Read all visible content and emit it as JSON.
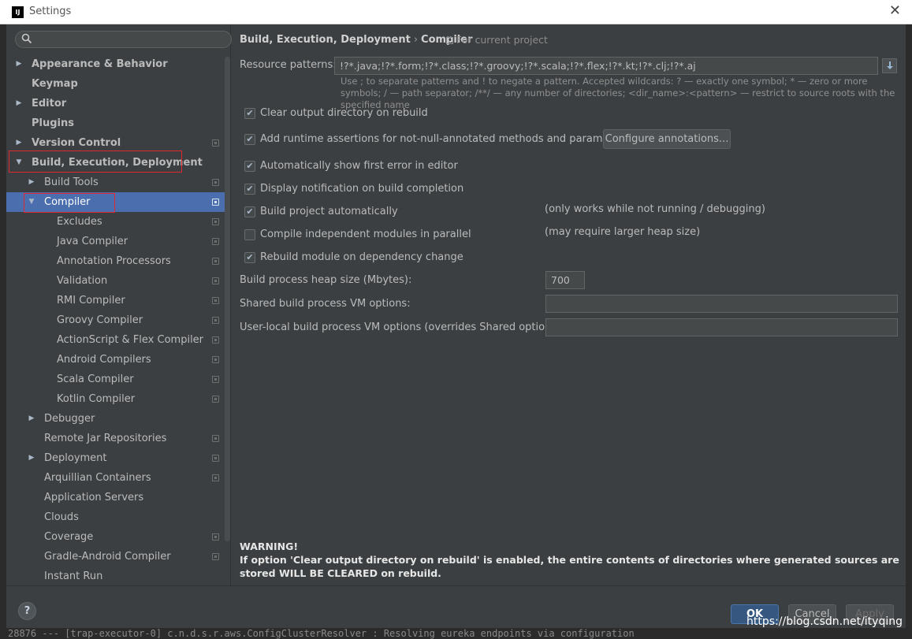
{
  "window": {
    "title": "Settings",
    "logo_text": "IJ"
  },
  "search": {
    "placeholder": ""
  },
  "tree": [
    {
      "label": "Appearance & Behavior",
      "arrow": "▶",
      "bold": true,
      "level": 0
    },
    {
      "label": "Keymap",
      "arrow": "",
      "bold": true,
      "level": 0
    },
    {
      "label": "Editor",
      "arrow": "▶",
      "bold": true,
      "level": 0
    },
    {
      "label": "Plugins",
      "arrow": "",
      "bold": true,
      "level": 0
    },
    {
      "label": "Version Control",
      "arrow": "▶",
      "bold": true,
      "level": 0,
      "copy": true
    },
    {
      "label": "Build, Execution, Deployment",
      "arrow": "▼",
      "bold": true,
      "level": 0
    },
    {
      "label": "Build Tools",
      "arrow": "▶",
      "bold": false,
      "level": 1,
      "copy": true
    },
    {
      "label": "Compiler",
      "arrow": "▼",
      "bold": false,
      "level": 1,
      "copy": true,
      "selected": true
    },
    {
      "label": "Excludes",
      "arrow": "",
      "bold": false,
      "level": 2,
      "copy": true
    },
    {
      "label": "Java Compiler",
      "arrow": "",
      "bold": false,
      "level": 2,
      "copy": true
    },
    {
      "label": "Annotation Processors",
      "arrow": "",
      "bold": false,
      "level": 2,
      "copy": true
    },
    {
      "label": "Validation",
      "arrow": "",
      "bold": false,
      "level": 2,
      "copy": true
    },
    {
      "label": "RMI Compiler",
      "arrow": "",
      "bold": false,
      "level": 2,
      "copy": true
    },
    {
      "label": "Groovy Compiler",
      "arrow": "",
      "bold": false,
      "level": 2,
      "copy": true
    },
    {
      "label": "ActionScript & Flex Compiler",
      "arrow": "",
      "bold": false,
      "level": 2,
      "copy": true
    },
    {
      "label": "Android Compilers",
      "arrow": "",
      "bold": false,
      "level": 2,
      "copy": true
    },
    {
      "label": "Scala Compiler",
      "arrow": "",
      "bold": false,
      "level": 2,
      "copy": true
    },
    {
      "label": "Kotlin Compiler",
      "arrow": "",
      "bold": false,
      "level": 2,
      "copy": true
    },
    {
      "label": "Debugger",
      "arrow": "▶",
      "bold": false,
      "level": 1
    },
    {
      "label": "Remote Jar Repositories",
      "arrow": "",
      "bold": false,
      "level": 1,
      "copy": true
    },
    {
      "label": "Deployment",
      "arrow": "▶",
      "bold": false,
      "level": 1,
      "copy": true
    },
    {
      "label": "Arquillian Containers",
      "arrow": "",
      "bold": false,
      "level": 1,
      "copy": true
    },
    {
      "label": "Application Servers",
      "arrow": "",
      "bold": false,
      "level": 1
    },
    {
      "label": "Clouds",
      "arrow": "",
      "bold": false,
      "level": 1
    },
    {
      "label": "Coverage",
      "arrow": "",
      "bold": false,
      "level": 1,
      "copy": true
    },
    {
      "label": "Gradle-Android Compiler",
      "arrow": "",
      "bold": false,
      "level": 1,
      "copy": true
    },
    {
      "label": "Instant Run",
      "arrow": "",
      "bold": false,
      "level": 1
    }
  ],
  "breadcrumb": {
    "parent": "Build, Execution, Deployment",
    "separator": "›",
    "current": "Compiler",
    "scope": "For current project"
  },
  "resource_patterns": {
    "label": "Resource patterns:",
    "value": "!?*.java;!?*.form;!?*.class;!?*.groovy;!?*.scala;!?*.flex;!?*.kt;!?*.clj;!?*.aj",
    "hint": "Use ; to separate patterns and ! to negate a pattern. Accepted wildcards: ? — exactly one symbol; * — zero or more symbols; / — path separator; /**/ — any number of directories; <dir_name>:<pattern> — restrict to source roots with the specified name"
  },
  "options": [
    {
      "label": "Clear output directory on rebuild",
      "checked": true,
      "note": ""
    },
    {
      "label": "Add runtime assertions for not-null-annotated methods and parameters",
      "checked": true,
      "note": ""
    },
    {
      "label": "Automatically show first error in editor",
      "checked": true,
      "note": ""
    },
    {
      "label": "Display notification on build completion",
      "checked": true,
      "note": ""
    },
    {
      "label": "Build project automatically",
      "checked": true,
      "note": "(only works while not running / debugging)"
    },
    {
      "label": "Compile independent modules in parallel",
      "checked": false,
      "note": "(may require larger heap size)"
    },
    {
      "label": "Rebuild module on dependency change",
      "checked": true,
      "note": ""
    }
  ],
  "configure_annotations_label": "Configure annotations...",
  "heap": {
    "label": "Build process heap size (Mbytes):",
    "value": "700"
  },
  "shared_vm": {
    "label": "Shared build process VM options:",
    "value": ""
  },
  "user_vm": {
    "label": "User-local build process VM options (overrides Shared options):",
    "value": ""
  },
  "warning": {
    "title": "WARNING!",
    "text": "If option 'Clear output directory on rebuild' is enabled, the entire contents of directories where generated sources are stored WILL BE CLEARED on rebuild."
  },
  "footer": {
    "help": "?",
    "ok": "OK",
    "cancel": "Cancel",
    "apply": "Apply"
  },
  "background_console": "28876 --- [trap-executor-0] c.n.d.s.r.aws.ConfigClusterResolver      : Resolving eureka endpoints via configuration",
  "watermark": "https://blog.csdn.net/ityqing",
  "colors": {
    "background": "#3c3f41",
    "selection": "#4b6eaf",
    "highlight_box": "#e0282f",
    "ok_button": "#365880"
  }
}
